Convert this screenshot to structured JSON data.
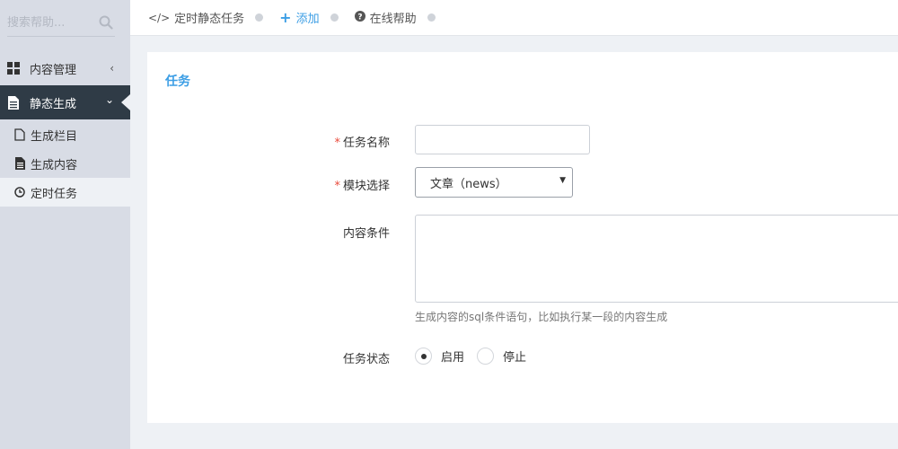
{
  "sidebar": {
    "search_placeholder": "搜索帮助...",
    "menu": [
      {
        "label": "内容管理",
        "icon": "grid-icon",
        "caret": "‹"
      },
      {
        "label": "静态生成",
        "icon": "document-icon",
        "caret": "⌄"
      }
    ],
    "submenu": [
      {
        "label": "生成栏目",
        "icon": "file-outline-icon"
      },
      {
        "label": "生成内容",
        "icon": "file-text-icon"
      },
      {
        "label": "定时任务",
        "icon": "clock-icon"
      }
    ]
  },
  "topbar": {
    "crumbs": [
      {
        "icon": "</>",
        "label": "定时静态任务"
      },
      {
        "icon": "+",
        "label": "添加"
      },
      {
        "icon": "?",
        "label": "在线帮助"
      }
    ]
  },
  "panel": {
    "title": "任务",
    "required_mark": "*",
    "fields": {
      "name_label": "任务名称",
      "name_value": "",
      "module_label": "模块选择",
      "module_value": "文章（news）",
      "condition_label": "内容条件",
      "condition_help": "生成内容的sql条件语句，比如执行某一段的内容生成",
      "status_label": "任务状态",
      "status_options": [
        "启用",
        "停止"
      ],
      "status_selected": "启用"
    }
  },
  "colors": {
    "accent": "#3c9ee5",
    "sidebar_bg": "#d8dce5",
    "sidebar_active": "#2f3b46",
    "required": "#e94b3c"
  }
}
